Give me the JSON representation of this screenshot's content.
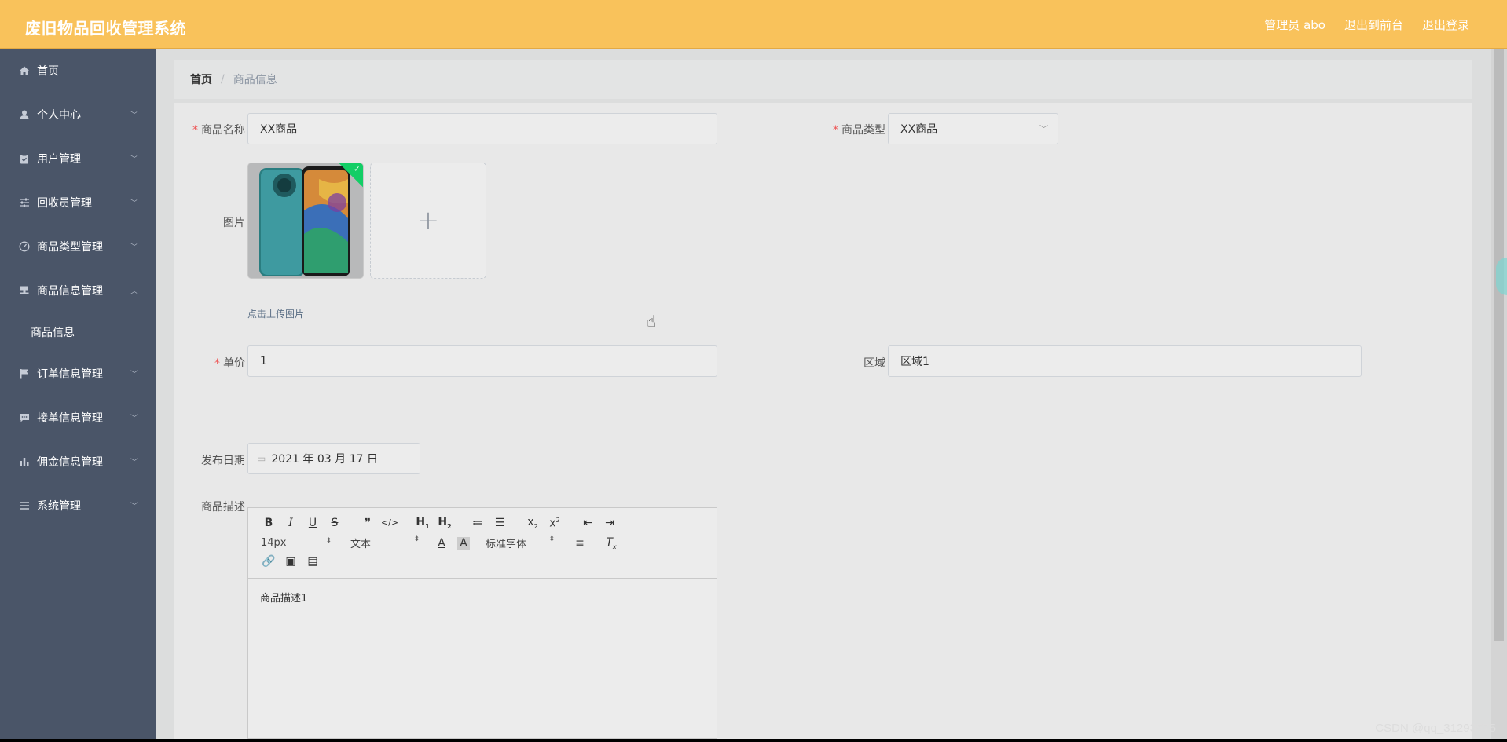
{
  "header": {
    "title": "废旧物品回收管理系统",
    "admin": "管理员 abo",
    "front": "退出到前台",
    "logout": "退出登录"
  },
  "sidebar": {
    "items": [
      {
        "label": "首页",
        "icon": "home-icon"
      },
      {
        "label": "个人中心",
        "icon": "user-icon"
      },
      {
        "label": "用户管理",
        "icon": "clipboard-icon"
      },
      {
        "label": "回收员管理",
        "icon": "sliders-icon"
      },
      {
        "label": "商品类型管理",
        "icon": "gauge-icon"
      },
      {
        "label": "商品信息管理",
        "icon": "stamp-icon"
      },
      {
        "label": "订单信息管理",
        "icon": "flag-icon"
      },
      {
        "label": "接单信息管理",
        "icon": "message-icon"
      },
      {
        "label": "佣金信息管理",
        "icon": "bar-chart-icon"
      },
      {
        "label": "系统管理",
        "icon": "menu-icon"
      }
    ],
    "sub_item": "商品信息"
  },
  "breadcrumb": {
    "home": "首页",
    "separator": "/",
    "current": "商品信息"
  },
  "form": {
    "name_label": "商品名称",
    "name_value": "XX商品",
    "type_label": "商品类型",
    "type_value": "XX商品",
    "image_label": "图片",
    "upload_tip": "点击上传图片",
    "price_label": "单价",
    "price_value": "1",
    "region_label": "区域",
    "region_value": "区域1",
    "date_label": "发布日期",
    "date_value": "2021 年 03 月 17 日",
    "desc_label": "商品描述",
    "desc_value": "商品描述1",
    "required_mark": "*"
  },
  "editor": {
    "font_size": "14px",
    "block_type": "文本",
    "font_family": "标准字体"
  },
  "watermark": "CSDN @qq_31293575",
  "colors": {
    "header": "#f9c25b",
    "sidebar": "#4a5568",
    "success_badge": "#13ce66"
  }
}
